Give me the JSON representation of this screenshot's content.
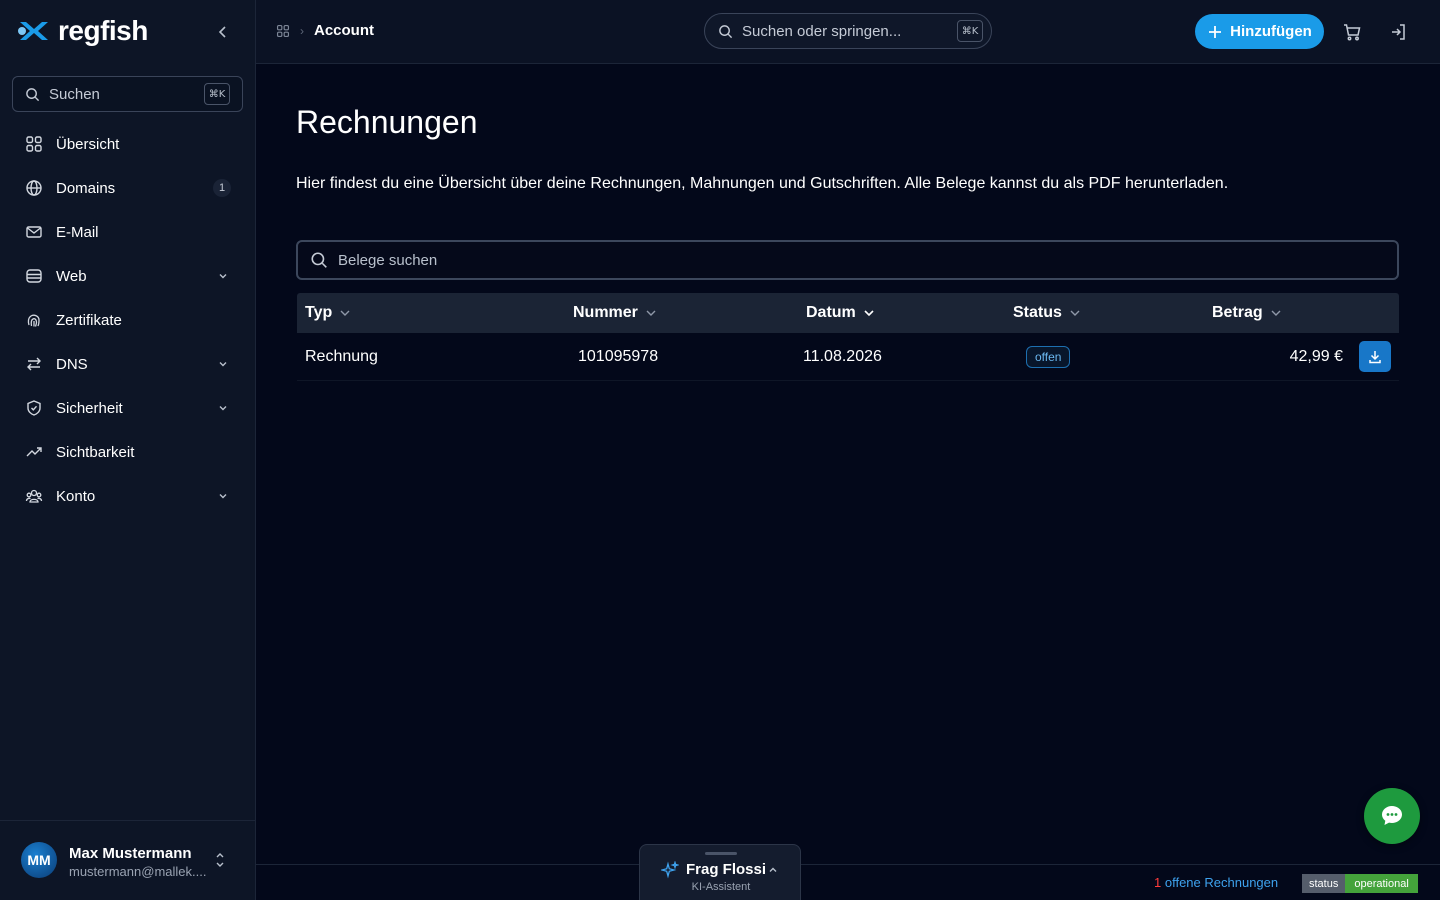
{
  "brand": {
    "name": "regfish",
    "accent": "#1a9be8"
  },
  "sidebar": {
    "search_label": "Suchen",
    "search_shortcut": "⌘K",
    "items": [
      {
        "label": "Übersicht",
        "icon": "grid-icon"
      },
      {
        "label": "Domains",
        "icon": "globe-icon",
        "badge": "1"
      },
      {
        "label": "E-Mail",
        "icon": "mail-icon"
      },
      {
        "label": "Web",
        "icon": "server-icon",
        "expandable": true
      },
      {
        "label": "Zertifikate",
        "icon": "fingerprint-icon"
      },
      {
        "label": "DNS",
        "icon": "arrows-icon",
        "expandable": true
      },
      {
        "label": "Sicherheit",
        "icon": "shield-icon",
        "expandable": true
      },
      {
        "label": "Sichtbarkeit",
        "icon": "trend-icon"
      },
      {
        "label": "Konto",
        "icon": "users-icon",
        "expandable": true
      }
    ],
    "user": {
      "initials": "MM",
      "name": "Max Mustermann",
      "email": "mustermann@mallek...."
    }
  },
  "header": {
    "breadcrumb": {
      "current": "Account"
    },
    "search_placeholder": "Suchen oder springen...",
    "search_shortcut": "⌘K",
    "add_button": "Hinzufügen"
  },
  "main": {
    "title": "Rechnungen",
    "description": "Hier findest du eine Übersicht über deine Rechnungen, Mahnungen und Gutschriften. Alle Belege kannst du als PDF herunterladen.",
    "search_placeholder": "Belege suchen",
    "table": {
      "columns": [
        "Typ",
        "Nummer",
        "Datum",
        "Status",
        "Betrag"
      ],
      "rows": [
        {
          "typ": "Rechnung",
          "nummer": "101095978",
          "datum": "11.08.2026",
          "status": "offen",
          "betrag": "42,99 €"
        }
      ]
    }
  },
  "footer": {
    "open_count": "1",
    "open_label": "offene Rechnungen",
    "status_label": "status",
    "status_value": "operational"
  },
  "assistant": {
    "name": "Frag Flossi",
    "subtitle": "KI-Assistent"
  }
}
